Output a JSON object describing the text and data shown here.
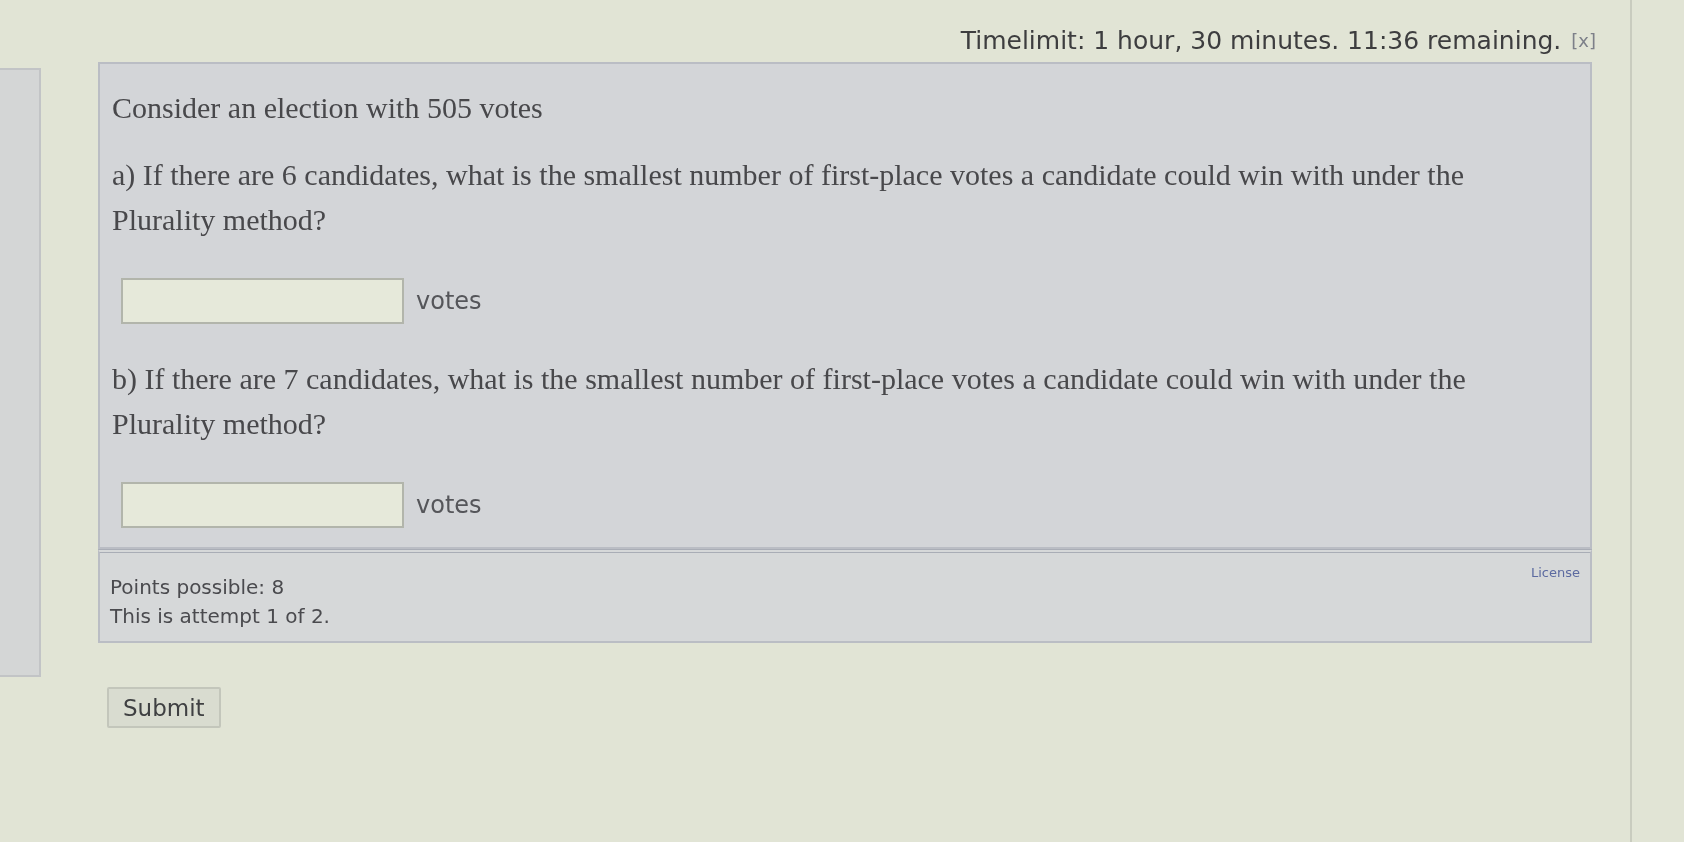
{
  "timer": {
    "text": "Timelimit: 1 hour, 30 minutes. 11:36 remaining.",
    "close": "[x]"
  },
  "question": {
    "intro": "Consider an election with 505 votes",
    "parts": [
      {
        "prompt": "a) If there are 6 candidates, what is the smallest number of first-place votes a candidate could win with under the Plurality method?",
        "unit": "votes"
      },
      {
        "prompt": "b) If there are 7 candidates, what is the smallest number of first-place votes a candidate could win with under the Plurality method?",
        "unit": "votes"
      }
    ]
  },
  "footer": {
    "points": "Points possible: 8",
    "attempt": "This is attempt 1 of 2.",
    "license": "License"
  },
  "submit": "Submit"
}
